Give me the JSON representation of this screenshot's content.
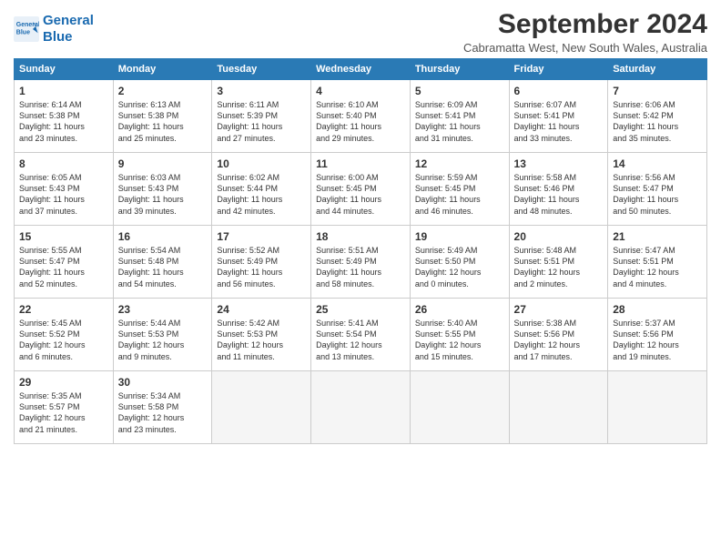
{
  "logo": {
    "line1": "General",
    "line2": "Blue"
  },
  "title": "September 2024",
  "subtitle": "Cabramatta West, New South Wales, Australia",
  "days_header": [
    "Sunday",
    "Monday",
    "Tuesday",
    "Wednesday",
    "Thursday",
    "Friday",
    "Saturday"
  ],
  "weeks": [
    [
      {
        "day": 1,
        "info": "Sunrise: 6:14 AM\nSunset: 5:38 PM\nDaylight: 11 hours\nand 23 minutes."
      },
      {
        "day": 2,
        "info": "Sunrise: 6:13 AM\nSunset: 5:38 PM\nDaylight: 11 hours\nand 25 minutes."
      },
      {
        "day": 3,
        "info": "Sunrise: 6:11 AM\nSunset: 5:39 PM\nDaylight: 11 hours\nand 27 minutes."
      },
      {
        "day": 4,
        "info": "Sunrise: 6:10 AM\nSunset: 5:40 PM\nDaylight: 11 hours\nand 29 minutes."
      },
      {
        "day": 5,
        "info": "Sunrise: 6:09 AM\nSunset: 5:41 PM\nDaylight: 11 hours\nand 31 minutes."
      },
      {
        "day": 6,
        "info": "Sunrise: 6:07 AM\nSunset: 5:41 PM\nDaylight: 11 hours\nand 33 minutes."
      },
      {
        "day": 7,
        "info": "Sunrise: 6:06 AM\nSunset: 5:42 PM\nDaylight: 11 hours\nand 35 minutes."
      }
    ],
    [
      {
        "day": 8,
        "info": "Sunrise: 6:05 AM\nSunset: 5:43 PM\nDaylight: 11 hours\nand 37 minutes."
      },
      {
        "day": 9,
        "info": "Sunrise: 6:03 AM\nSunset: 5:43 PM\nDaylight: 11 hours\nand 39 minutes."
      },
      {
        "day": 10,
        "info": "Sunrise: 6:02 AM\nSunset: 5:44 PM\nDaylight: 11 hours\nand 42 minutes."
      },
      {
        "day": 11,
        "info": "Sunrise: 6:00 AM\nSunset: 5:45 PM\nDaylight: 11 hours\nand 44 minutes."
      },
      {
        "day": 12,
        "info": "Sunrise: 5:59 AM\nSunset: 5:45 PM\nDaylight: 11 hours\nand 46 minutes."
      },
      {
        "day": 13,
        "info": "Sunrise: 5:58 AM\nSunset: 5:46 PM\nDaylight: 11 hours\nand 48 minutes."
      },
      {
        "day": 14,
        "info": "Sunrise: 5:56 AM\nSunset: 5:47 PM\nDaylight: 11 hours\nand 50 minutes."
      }
    ],
    [
      {
        "day": 15,
        "info": "Sunrise: 5:55 AM\nSunset: 5:47 PM\nDaylight: 11 hours\nand 52 minutes."
      },
      {
        "day": 16,
        "info": "Sunrise: 5:54 AM\nSunset: 5:48 PM\nDaylight: 11 hours\nand 54 minutes."
      },
      {
        "day": 17,
        "info": "Sunrise: 5:52 AM\nSunset: 5:49 PM\nDaylight: 11 hours\nand 56 minutes."
      },
      {
        "day": 18,
        "info": "Sunrise: 5:51 AM\nSunset: 5:49 PM\nDaylight: 11 hours\nand 58 minutes."
      },
      {
        "day": 19,
        "info": "Sunrise: 5:49 AM\nSunset: 5:50 PM\nDaylight: 12 hours\nand 0 minutes."
      },
      {
        "day": 20,
        "info": "Sunrise: 5:48 AM\nSunset: 5:51 PM\nDaylight: 12 hours\nand 2 minutes."
      },
      {
        "day": 21,
        "info": "Sunrise: 5:47 AM\nSunset: 5:51 PM\nDaylight: 12 hours\nand 4 minutes."
      }
    ],
    [
      {
        "day": 22,
        "info": "Sunrise: 5:45 AM\nSunset: 5:52 PM\nDaylight: 12 hours\nand 6 minutes."
      },
      {
        "day": 23,
        "info": "Sunrise: 5:44 AM\nSunset: 5:53 PM\nDaylight: 12 hours\nand 9 minutes."
      },
      {
        "day": 24,
        "info": "Sunrise: 5:42 AM\nSunset: 5:53 PM\nDaylight: 12 hours\nand 11 minutes."
      },
      {
        "day": 25,
        "info": "Sunrise: 5:41 AM\nSunset: 5:54 PM\nDaylight: 12 hours\nand 13 minutes."
      },
      {
        "day": 26,
        "info": "Sunrise: 5:40 AM\nSunset: 5:55 PM\nDaylight: 12 hours\nand 15 minutes."
      },
      {
        "day": 27,
        "info": "Sunrise: 5:38 AM\nSunset: 5:56 PM\nDaylight: 12 hours\nand 17 minutes."
      },
      {
        "day": 28,
        "info": "Sunrise: 5:37 AM\nSunset: 5:56 PM\nDaylight: 12 hours\nand 19 minutes."
      }
    ],
    [
      {
        "day": 29,
        "info": "Sunrise: 5:35 AM\nSunset: 5:57 PM\nDaylight: 12 hours\nand 21 minutes."
      },
      {
        "day": 30,
        "info": "Sunrise: 5:34 AM\nSunset: 5:58 PM\nDaylight: 12 hours\nand 23 minutes."
      },
      null,
      null,
      null,
      null,
      null
    ]
  ]
}
